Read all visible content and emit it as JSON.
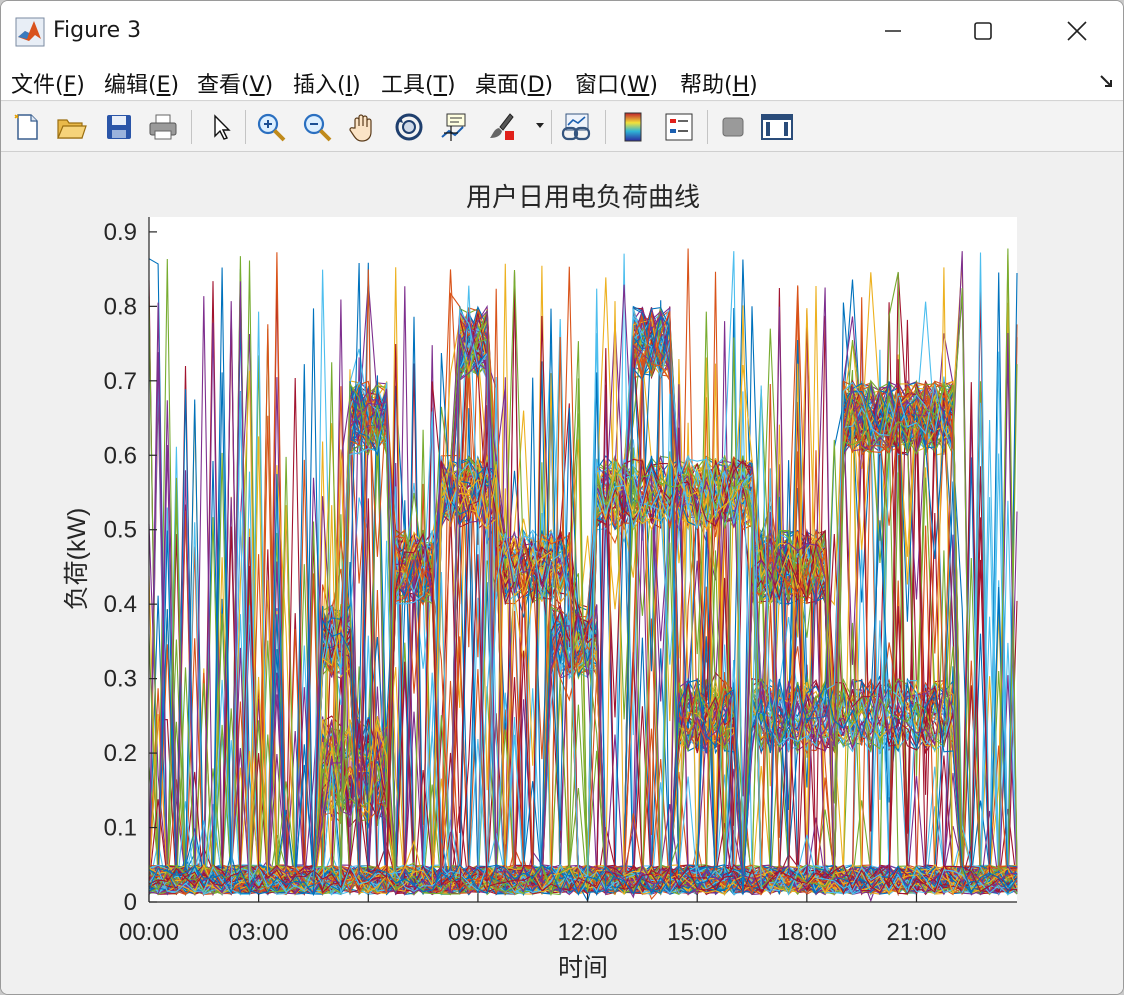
{
  "window": {
    "title": "Figure 3",
    "controls": [
      "minimize",
      "maximize",
      "close"
    ]
  },
  "menu": [
    {
      "label": "文件(",
      "key": "F",
      "end": ")"
    },
    {
      "label": "编辑(",
      "key": "E",
      "end": ")"
    },
    {
      "label": "查看(",
      "key": "V",
      "end": ")"
    },
    {
      "label": "插入(",
      "key": "I",
      "end": ")"
    },
    {
      "label": "工具(",
      "key": "T",
      "end": ")"
    },
    {
      "label": "桌面(",
      "key": "D",
      "end": ")"
    },
    {
      "label": "窗口(",
      "key": "W",
      "end": ")"
    },
    {
      "label": "帮助(",
      "key": "H",
      "end": ")"
    }
  ],
  "toolbar": {
    "icons": [
      "new-figure-icon",
      "open-file-icon",
      "save-icon",
      "print-icon",
      "pointer-icon",
      "zoom-in-icon",
      "zoom-out-icon",
      "pan-hand-icon",
      "rotate-3d-icon",
      "data-cursor-icon",
      "brush-icon",
      "link-plot-icon",
      "colorbar-icon",
      "legend-icon",
      "hide-plot-tools-icon",
      "show-plot-tools-icon"
    ]
  },
  "chart_data": {
    "type": "line",
    "title": "用户日用电负荷曲线",
    "xlabel": "时间",
    "ylabel": "负荷(kW)",
    "x_ticks": [
      "00:00",
      "03:00",
      "06:00",
      "09:00",
      "12:00",
      "15:00",
      "18:00",
      "21:00"
    ],
    "x_tick_hours": [
      0,
      3,
      6,
      9,
      12,
      15,
      18,
      21
    ],
    "xlim_hours": [
      0,
      23.75
    ],
    "interval_minutes": 15,
    "y_ticks": [
      0,
      0.1,
      0.2,
      0.3,
      0.4,
      0.5,
      0.6,
      0.7,
      0.8,
      0.9
    ],
    "ylim": [
      0,
      0.92
    ],
    "grid": false,
    "legend": "none",
    "series_count_estimate": 1000,
    "colors": [
      "#0072BD",
      "#D95319",
      "#EDB120",
      "#7E2F8E",
      "#77AC30",
      "#4DBEEE",
      "#A2142F"
    ],
    "load_bands_kw": [
      {
        "start": "04:45",
        "end": "05:30",
        "low": 0.3,
        "high": 0.4
      },
      {
        "start": "05:30",
        "end": "06:30",
        "low": 0.6,
        "high": 0.7
      },
      {
        "start": "06:45",
        "end": "07:45",
        "low": 0.4,
        "high": 0.5
      },
      {
        "start": "08:30",
        "end": "09:15",
        "low": 0.7,
        "high": 0.8
      },
      {
        "start": "08:00",
        "end": "09:30",
        "low": 0.5,
        "high": 0.6
      },
      {
        "start": "09:30",
        "end": "11:30",
        "low": 0.4,
        "high": 0.5
      },
      {
        "start": "11:00",
        "end": "12:15",
        "low": 0.3,
        "high": 0.4
      },
      {
        "start": "12:15",
        "end": "16:30",
        "low": 0.5,
        "high": 0.6
      },
      {
        "start": "13:15",
        "end": "14:15",
        "low": 0.7,
        "high": 0.8
      },
      {
        "start": "14:30",
        "end": "16:00",
        "low": 0.2,
        "high": 0.3
      },
      {
        "start": "16:30",
        "end": "18:30",
        "low": 0.4,
        "high": 0.5
      },
      {
        "start": "16:30",
        "end": "22:00",
        "low": 0.2,
        "high": 0.3
      },
      {
        "start": "19:00",
        "end": "22:00",
        "low": 0.6,
        "high": 0.7
      },
      {
        "start": "04:45",
        "end": "06:30",
        "low": 0.1,
        "high": 0.25
      }
    ],
    "base_load_kw": {
      "low": 0.01,
      "high": 0.05
    }
  }
}
